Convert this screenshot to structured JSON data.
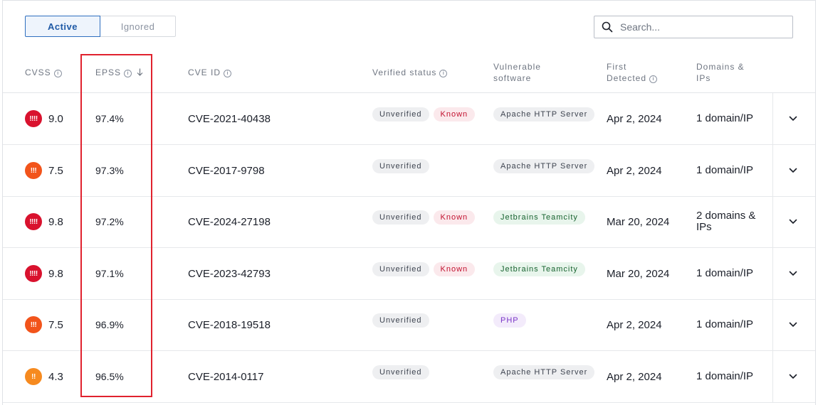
{
  "tabs": {
    "active": "Active",
    "ignored": "Ignored"
  },
  "search": {
    "placeholder": "Search..."
  },
  "columns": {
    "cvss": "CVSS",
    "epss": "EPSS",
    "cve_id": "CVE ID",
    "verified": "Verified status",
    "vulnerable_1": "Vulnerable",
    "vulnerable_2": "software",
    "first_1": "First",
    "first_2": "Detected",
    "domains_1": "Domains &",
    "domains_2": "IPs"
  },
  "colors": {
    "critical": "#d9122e",
    "high": "#f2541b",
    "medium": "#f68a1f",
    "highlight": "#e0222e",
    "accent": "#1f5aa6"
  },
  "rows": [
    {
      "severity_icon": "!!!!",
      "severity_level": "critical",
      "cvss": "9.0",
      "epss": "97.4%",
      "cve": "CVE-2021-40438",
      "verified": "Unverified",
      "known": "Known",
      "software": "Apache HTTP Server",
      "software_style": "apache",
      "date": "Apr 2, 2024",
      "domains": "1 domain/IP"
    },
    {
      "severity_icon": "!!!",
      "severity_level": "high",
      "cvss": "7.5",
      "epss": "97.3%",
      "cve": "CVE-2017-9798",
      "verified": "Unverified",
      "known": "",
      "software": "Apache HTTP Server",
      "software_style": "apache",
      "date": "Apr 2, 2024",
      "domains": "1 domain/IP"
    },
    {
      "severity_icon": "!!!!",
      "severity_level": "critical",
      "cvss": "9.8",
      "epss": "97.2%",
      "cve": "CVE-2024-27198",
      "verified": "Unverified",
      "known": "Known",
      "software": "Jetbrains Teamcity",
      "software_style": "jet",
      "date": "Mar 20, 2024",
      "domains": "2 domains & IPs"
    },
    {
      "severity_icon": "!!!!",
      "severity_level": "critical",
      "cvss": "9.8",
      "epss": "97.1%",
      "cve": "CVE-2023-42793",
      "verified": "Unverified",
      "known": "Known",
      "software": "Jetbrains Teamcity",
      "software_style": "jet",
      "date": "Mar 20, 2024",
      "domains": "1 domain/IP"
    },
    {
      "severity_icon": "!!!",
      "severity_level": "high",
      "cvss": "7.5",
      "epss": "96.9%",
      "cve": "CVE-2018-19518",
      "verified": "Unverified",
      "known": "",
      "software": "PHP",
      "software_style": "php",
      "date": "Apr 2, 2024",
      "domains": "1 domain/IP"
    },
    {
      "severity_icon": "!!",
      "severity_level": "medium",
      "cvss": "4.3",
      "epss": "96.5%",
      "cve": "CVE-2014-0117",
      "verified": "Unverified",
      "known": "",
      "software": "Apache HTTP Server",
      "software_style": "apache",
      "date": "Apr 2, 2024",
      "domains": "1 domain/IP"
    }
  ]
}
